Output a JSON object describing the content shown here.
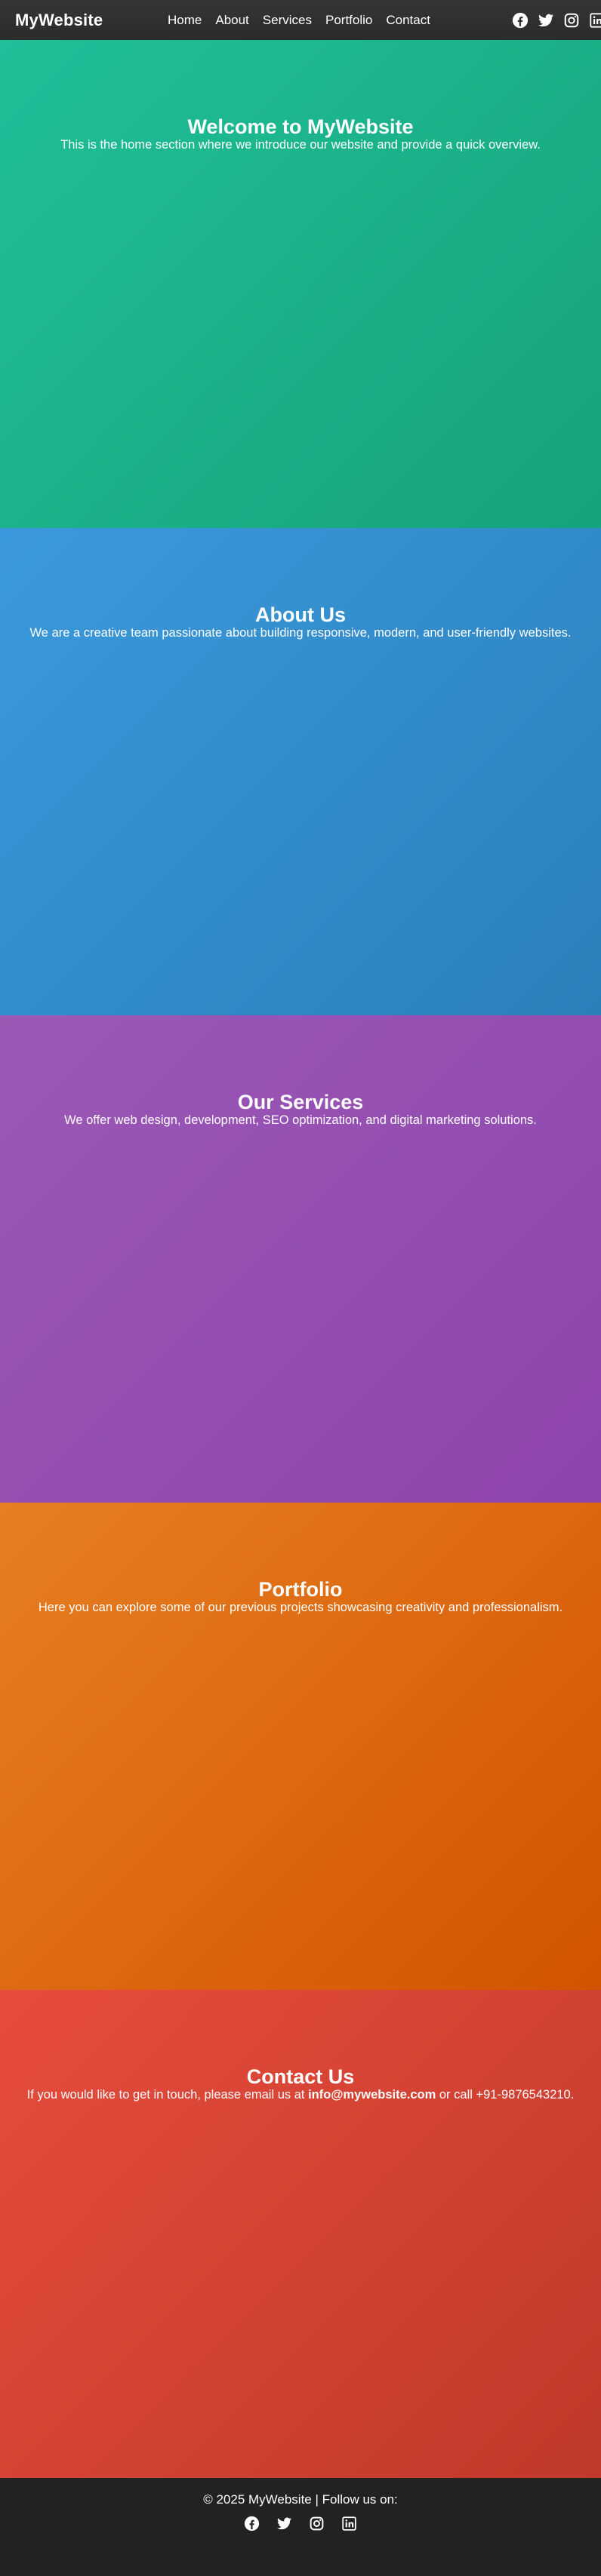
{
  "header": {
    "logo": "MyWebsite",
    "nav": [
      "Home",
      "About",
      "Services",
      "Portfolio",
      "Contact"
    ],
    "social_icons": [
      "facebook-icon",
      "twitter-icon",
      "instagram-icon",
      "linkedin-icon"
    ]
  },
  "sections": {
    "home": {
      "title": "Welcome to MyWebsite",
      "text": "This is the home section where we introduce our website and provide a quick overview.",
      "colors": [
        "#1fbf98",
        "#17a37c"
      ]
    },
    "about": {
      "title": "About Us",
      "text": "We are a creative team passionate about building responsive, modern, and user-friendly websites.",
      "colors": [
        "#3a99dc",
        "#2c80ba"
      ]
    },
    "services": {
      "title": "Our Services",
      "text": "We offer web design, development, SEO optimization, and digital marketing solutions.",
      "colors": [
        "#9b59b6",
        "#8e44ad"
      ]
    },
    "portfolio": {
      "title": "Portfolio",
      "text": "Here you can explore some of our previous projects showcasing creativity and professionalism.",
      "colors": [
        "#e67e22",
        "#d35400"
      ]
    },
    "contact": {
      "title": "Contact Us",
      "text_before": "If you would like to get in touch, please email us at ",
      "email": "info@mywebsite.com",
      "text_after": " or call +91-9876543210.",
      "colors": [
        "#e74c3c",
        "#c0392b"
      ]
    }
  },
  "footer": {
    "text": "© 2025 MyWebsite | Follow us on:",
    "social_icons": [
      "facebook-icon",
      "twitter-icon",
      "instagram-icon",
      "linkedin-icon"
    ]
  }
}
